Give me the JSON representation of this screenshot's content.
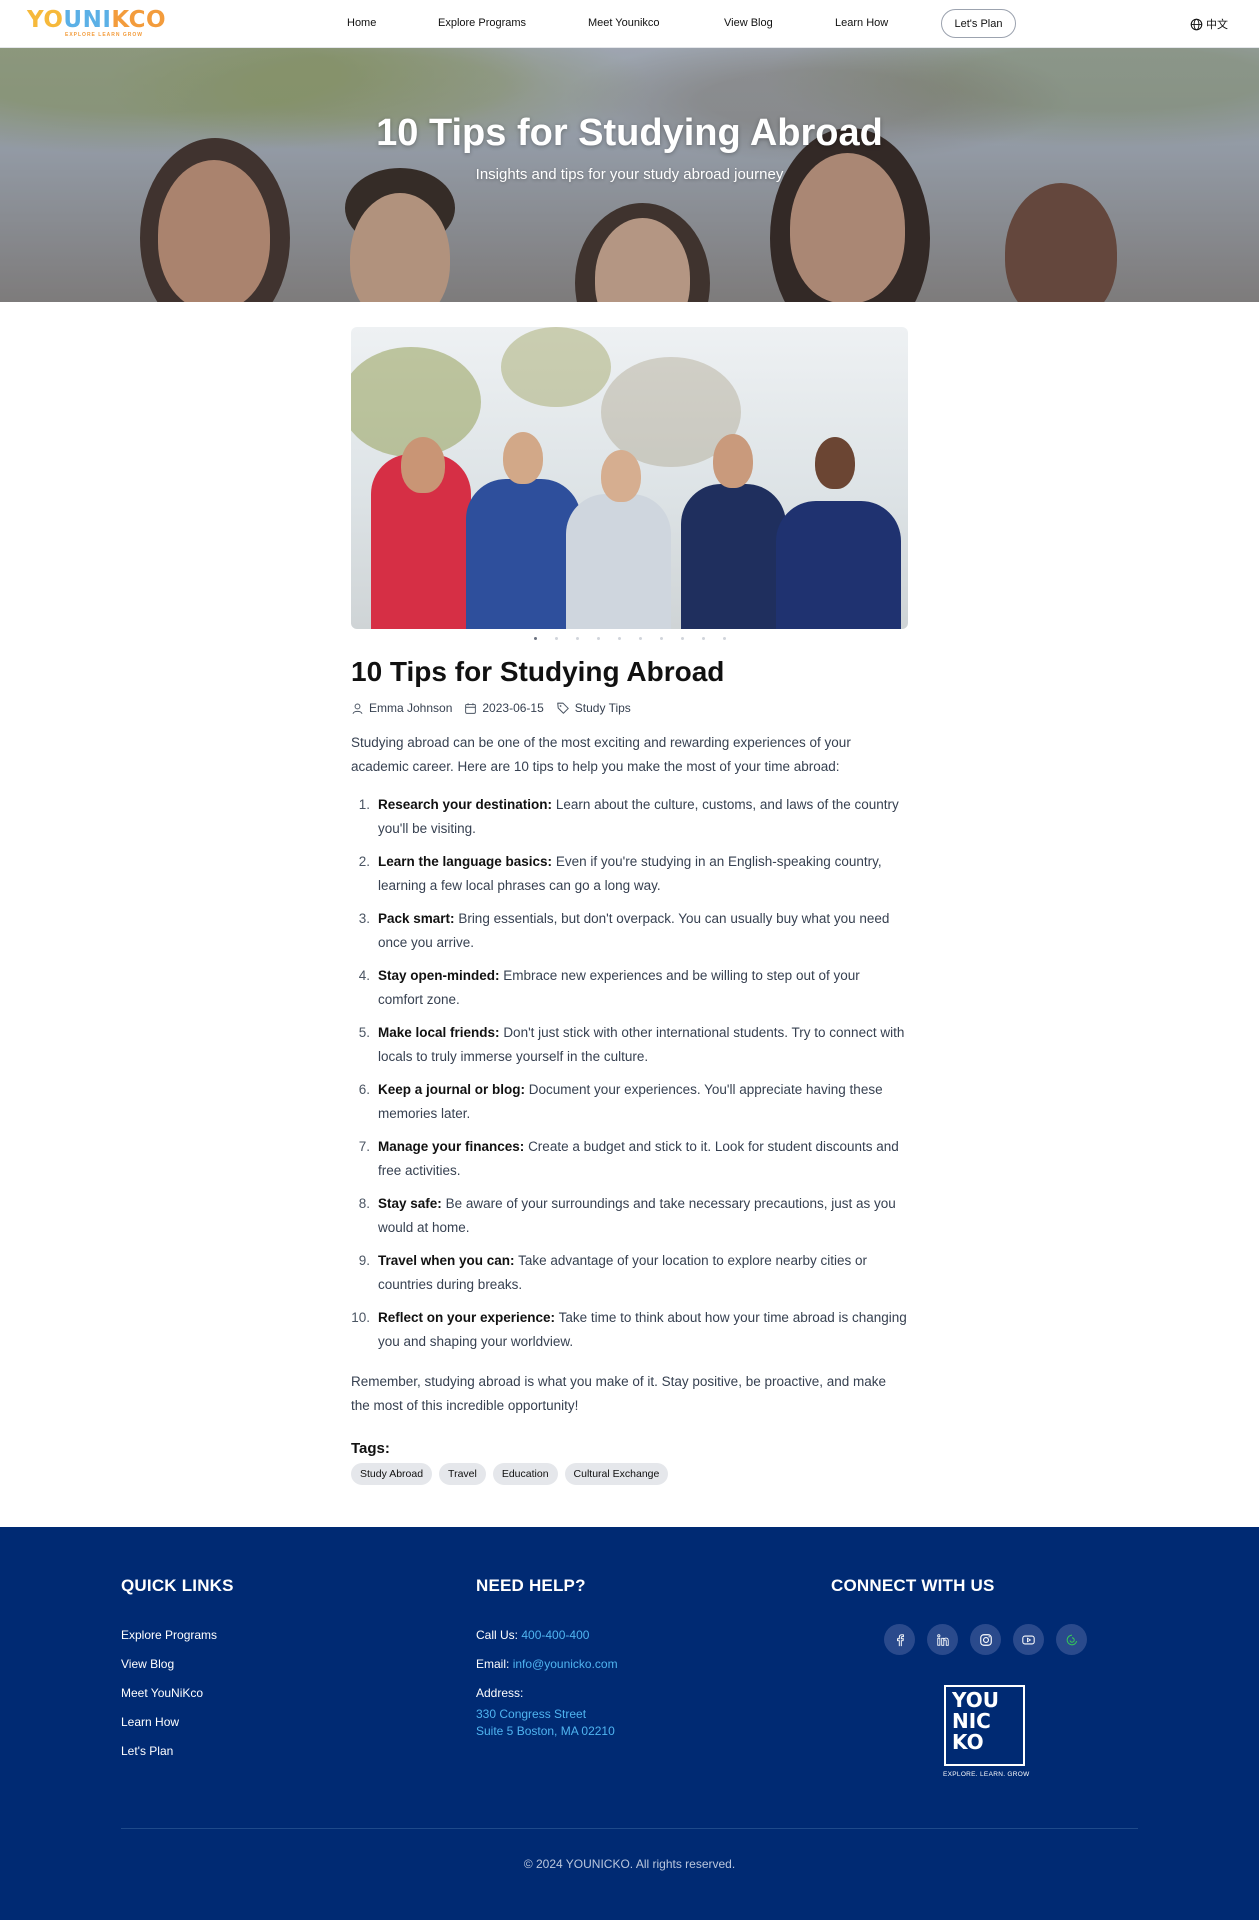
{
  "header": {
    "logo": "YOUNIKCO",
    "logo_tagline": "EXPLORE LEARN GROW",
    "nav": [
      "Home",
      "Explore Programs",
      "Meet Younikco",
      "View Blog",
      "Learn How"
    ],
    "cta": "Let's Plan",
    "language": "中文"
  },
  "hero": {
    "title": "10 Tips for Studying Abroad",
    "subtitle": "Insights and tips for your study abroad journey"
  },
  "article": {
    "title": "10 Tips for Studying Abroad",
    "author": "Emma Johnson",
    "date": "2023-06-15",
    "category": "Study Tips",
    "carousel_count": 10,
    "carousel_active": 1,
    "intro": "Studying abroad can be one of the most exciting and rewarding experiences of your academic career. Here are 10 tips to help you make the most of your time abroad:",
    "tips": [
      {
        "num": "1.",
        "bold": "Research your destination:",
        "text": "Learn about the culture, customs, and laws of the country you'll be visiting."
      },
      {
        "num": "2.",
        "bold": "Learn the language basics:",
        "text": "Even if you're studying in an English-speaking country, learning a few local phrases can go a long way."
      },
      {
        "num": "3.",
        "bold": "Pack smart:",
        "text": "Bring essentials, but don't overpack. You can usually buy what you need once you arrive."
      },
      {
        "num": "4.",
        "bold": "Stay open-minded:",
        "text": "Embrace new experiences and be willing to step out of your comfort zone."
      },
      {
        "num": "5.",
        "bold": "Make local friends:",
        "text": "Don't just stick with other international students. Try to connect with locals to truly immerse yourself in the culture."
      },
      {
        "num": "6.",
        "bold": "Keep a journal or blog:",
        "text": "Document your experiences. You'll appreciate having these memories later."
      },
      {
        "num": "7.",
        "bold": "Manage your finances:",
        "text": "Create a budget and stick to it. Look for student discounts and free activities."
      },
      {
        "num": "8.",
        "bold": "Stay safe:",
        "text": "Be aware of your surroundings and take necessary precautions, just as you would at home."
      },
      {
        "num": "9.",
        "bold": "Travel when you can:",
        "text": "Take advantage of your location to explore nearby cities or countries during breaks."
      },
      {
        "num": "10.",
        "bold": "Reflect on your experience:",
        "text": "Take time to think about how your time abroad is changing you and shaping your worldview."
      }
    ],
    "outro": "Remember, studying abroad is what you make of it. Stay positive, be proactive, and make the most of this incredible opportunity!",
    "tags_title": "Tags:",
    "tags": [
      "Study Abroad",
      "Travel",
      "Education",
      "Cultural Exchange"
    ]
  },
  "footer": {
    "quick_links_title": "QUICK LINKS",
    "quick_links": [
      "Explore Programs",
      "View Blog",
      "Meet YouNiKco",
      "Learn How",
      "Let's Plan"
    ],
    "help_title": "NEED HELP?",
    "call_label": "Call Us:",
    "phone": "400-400-400",
    "email_label": "Email:",
    "email": "info@younicko.com",
    "address_label": "Address:",
    "address_line1": "330 Congress Street",
    "address_line2": "Suite 5 Boston, MA 02210",
    "connect_title": "CONNECT WITH US",
    "socials": [
      "facebook-icon",
      "linkedin-icon",
      "instagram-icon",
      "youtube-icon",
      "wechat-icon"
    ],
    "logo_lines": [
      "YOU",
      "NIC",
      "KO"
    ],
    "logo_tagline": "EXPLORE. LEARN. GROW",
    "copyright": "© 2024 YOUNICKO. All rights reserved."
  },
  "colors": {
    "footer_bg": "#002a73",
    "link_blue": "#4fb4f0",
    "logo_yellow": "#f6b93b",
    "logo_blue": "#5bb0e6",
    "logo_orange": "#f39c3c"
  }
}
